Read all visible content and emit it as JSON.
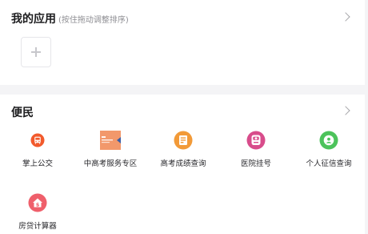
{
  "my_apps": {
    "title": "我的应用",
    "hint": "(按住拖动调整排序)"
  },
  "bianmin": {
    "title": "便民",
    "items": [
      {
        "label": "掌上公交",
        "icon": "bus-icon",
        "color": "#f25a2c"
      },
      {
        "label": "中高考服务专区",
        "icon": "exam-banner-icon",
        "color": "#f08a5d"
      },
      {
        "label": "高考成绩查询",
        "icon": "score-query-icon",
        "color": "#f29a38"
      },
      {
        "label": "医院挂号",
        "icon": "hospital-icon",
        "color": "#d84c8b"
      },
      {
        "label": "个人征信查询",
        "icon": "credit-query-icon",
        "color": "#4cc35b"
      },
      {
        "label": "房贷计算器",
        "icon": "mortgage-calculator-icon",
        "color": "#ef5f6b"
      }
    ]
  }
}
